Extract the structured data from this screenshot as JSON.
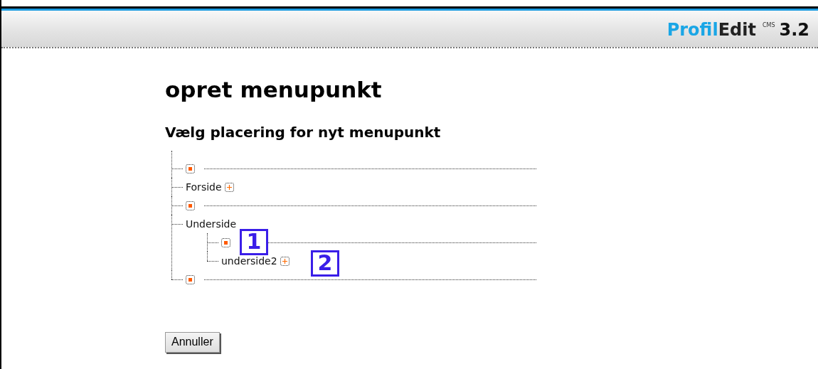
{
  "header": {
    "logo_part_1": "Profil",
    "logo_part_2": "Edit",
    "logo_sup": "CMS",
    "version": "3.2"
  },
  "title": "opret menupunkt",
  "subtitle": "Vælg placering for nyt menupunkt",
  "tree": [
    {
      "kind": "slot"
    },
    {
      "kind": "page",
      "label": "Forside",
      "has_plus": true
    },
    {
      "kind": "slot"
    },
    {
      "kind": "page",
      "label": "Underside",
      "has_plus": false,
      "children": [
        {
          "kind": "slot",
          "callout": "1"
        },
        {
          "kind": "page",
          "label": "underside2",
          "has_plus": true,
          "callout": "2"
        }
      ]
    },
    {
      "kind": "slot"
    }
  ],
  "buttons": [
    "Annuller"
  ]
}
